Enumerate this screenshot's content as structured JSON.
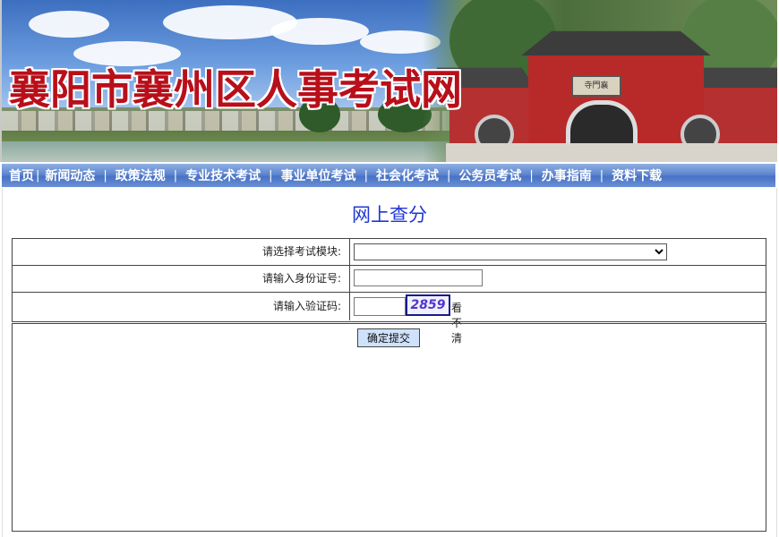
{
  "banner": {
    "site_title": "襄阳市襄州区人事考试网",
    "plaque_text": "寺門襄"
  },
  "nav": {
    "items": [
      "首页",
      "新闻动态",
      "政策法规",
      "专业技术考试",
      "事业单位考试",
      "社会化考试",
      "公务员考试",
      "办事指南",
      "资料下载"
    ],
    "separator": "|"
  },
  "page": {
    "title": "网上查分"
  },
  "form": {
    "module_label": "请选择考试模块:",
    "module_value": "",
    "id_label": "请输入身份证号:",
    "id_value": "",
    "code_label": "请输入验证码:",
    "code_value": "",
    "captcha_text": "2859",
    "refresh_label": "看不清",
    "submit_label": "确定提交"
  }
}
